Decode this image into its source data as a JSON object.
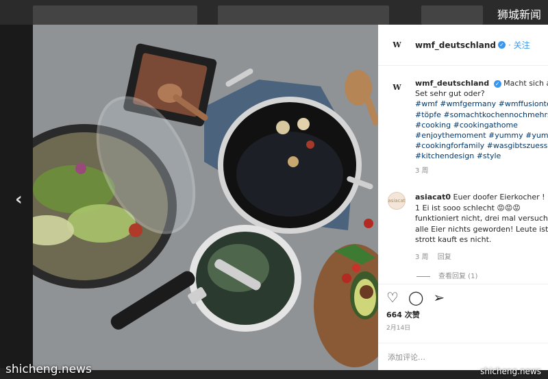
{
  "watermarks": {
    "top_right": "狮城新闻",
    "bottom_left": "shicheng.news",
    "bottom_right": "shicheng.news"
  },
  "header": {
    "logo": "W",
    "username": "wmf_deutschland",
    "follow_label": "关注",
    "verified_icon": "verified-badge-icon"
  },
  "caption": {
    "username": "wmf_deutschland",
    "text_lines": [
      "Macht sich auch",
      "Set sehr gut oder?"
    ],
    "hashtag_lines": [
      "#wmf #wmfgermany #wmffusiontec",
      "#töpfe #somachtkochennochmehrspaß",
      "#cooking #cookingathome",
      "#enjoythemoment #yummy #yummyfood",
      "#cookingforfamily #wasgibtszuessen",
      "#kitchendesign #style"
    ],
    "time": "3 周"
  },
  "comment": {
    "username": "asiacat0",
    "avatar_label": "asiacat",
    "text_lines": [
      "Euer doofer Eierkocher !",
      "1 Ei ist sooo schlecht 😡😡😡",
      "funktioniert nicht, drei mal versucht",
      "alle Eier nichts geworden! Leute ist",
      "strott kauft es nicht."
    ],
    "time": "3 周",
    "reply_label": "回复",
    "view_replies": "查看回复 (1)"
  },
  "actions": {
    "like_icon": "heart-icon",
    "comment_icon": "comment-icon",
    "share_icon": "share-icon"
  },
  "likes": "664 次赞",
  "date": "2月14日",
  "add_comment_placeholder": "添加评论…",
  "nav": {
    "prev": "‹",
    "next": "›"
  },
  "colors": {
    "accent": "#3897f0",
    "hashtag": "#00376b"
  }
}
